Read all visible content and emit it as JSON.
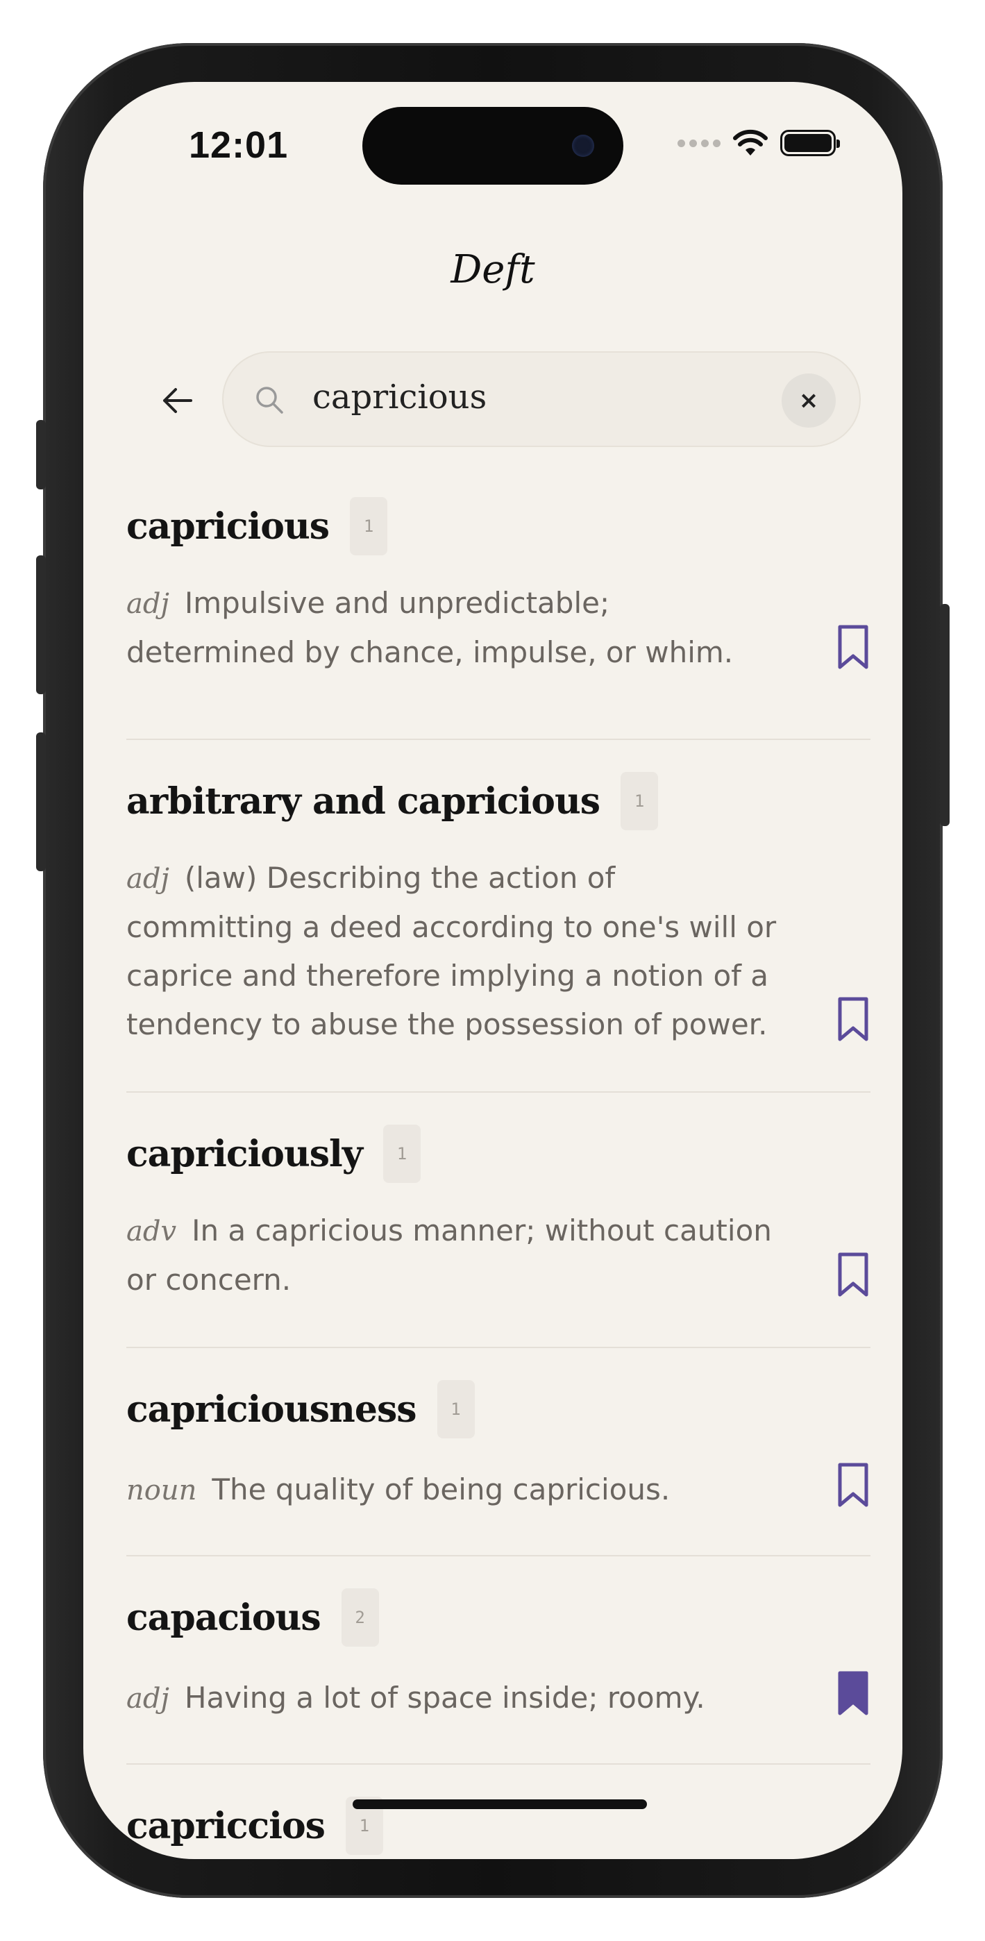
{
  "status_bar": {
    "time": "12:01"
  },
  "app": {
    "title": "Deft"
  },
  "search": {
    "query": "capricious",
    "clear_label": "×"
  },
  "colors": {
    "accent": "#5b4b9a",
    "background": "#f5f2ec",
    "text_primary": "#141414",
    "text_secondary": "#6a6560"
  },
  "results": [
    {
      "word": "capricious",
      "count": "1",
      "pos": "adj",
      "definition": "Impulsive and unpredictable; determined by chance, impulse, or whim.",
      "bookmarked": false
    },
    {
      "word": "arbitrary and capricious",
      "count": "1",
      "pos": "adj",
      "definition": "(law) Describing the action of committing a deed according to one's will or caprice and therefore implying a notion of a tendency to abuse the possession of power.",
      "bookmarked": false
    },
    {
      "word": "capriciously",
      "count": "1",
      "pos": "adv",
      "definition": "In a capricious manner; without caution or concern.",
      "bookmarked": false
    },
    {
      "word": "capriciousness",
      "count": "1",
      "pos": "noun",
      "definition": "The quality of being capricious.",
      "bookmarked": false
    },
    {
      "word": "capacious",
      "count": "2",
      "pos": "adj",
      "definition": "Having a lot of space inside; roomy.",
      "bookmarked": true
    },
    {
      "word": "capriccios",
      "count": "1",
      "pos": "",
      "definition": "",
      "bookmarked": false
    }
  ]
}
